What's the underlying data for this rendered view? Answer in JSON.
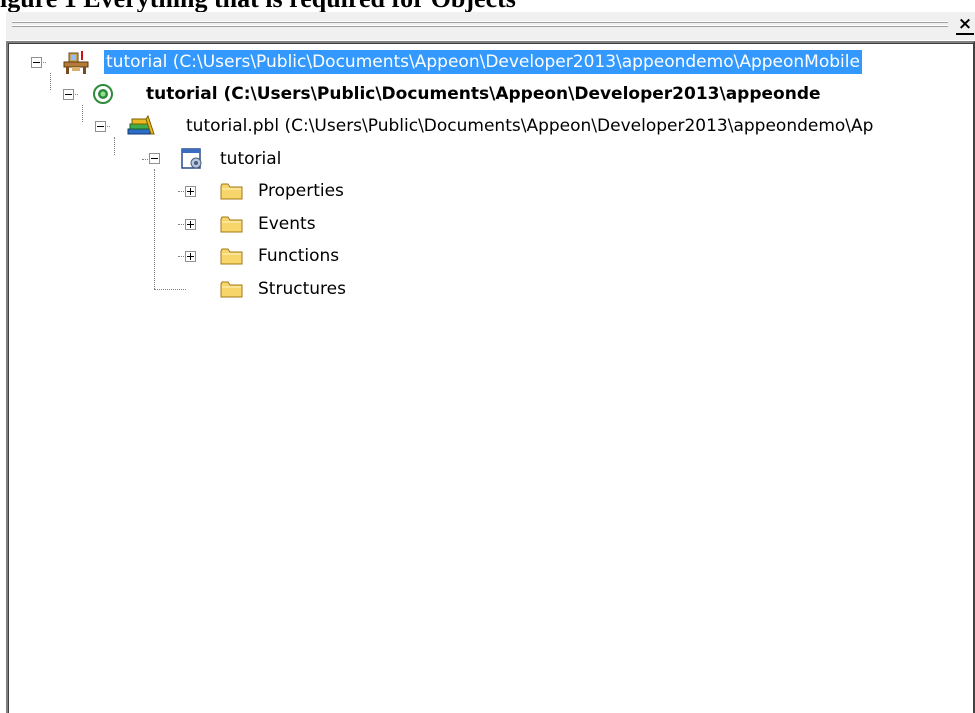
{
  "caption": "igure 1 Everything that is required for Objects",
  "pane": {
    "close_glyph": "×"
  },
  "tree": {
    "nodes": [
      {
        "label": "tutorial (C:\\Users\\Public\\Documents\\Appeon\\Developer2013\\appeondemo\\AppeonMobile",
        "icon": "workspace-icon",
        "expanded": true,
        "selected": true
      },
      {
        "label": "tutorial (C:\\Users\\Public\\Documents\\Appeon\\Developer2013\\appeonde",
        "icon": "target-icon",
        "expanded": true,
        "bold": true
      },
      {
        "label": "tutorial.pbl (C:\\Users\\Public\\Documents\\Appeon\\Developer2013\\appeondemo\\Ap",
        "icon": "library-books-icon",
        "expanded": true
      },
      {
        "label": "tutorial",
        "icon": "application-object-icon",
        "expanded": true
      },
      {
        "label": "Properties",
        "icon": "folder-icon",
        "expanded": false
      },
      {
        "label": "Events",
        "icon": "folder-icon",
        "expanded": false
      },
      {
        "label": "Functions",
        "icon": "folder-icon",
        "expanded": false
      },
      {
        "label": "Structures",
        "icon": "folder-icon",
        "expanded": null
      }
    ]
  },
  "colors": {
    "selection": "#3399ff",
    "target_green": "#2e8b3a",
    "folder_fill": "#f7d56b"
  }
}
